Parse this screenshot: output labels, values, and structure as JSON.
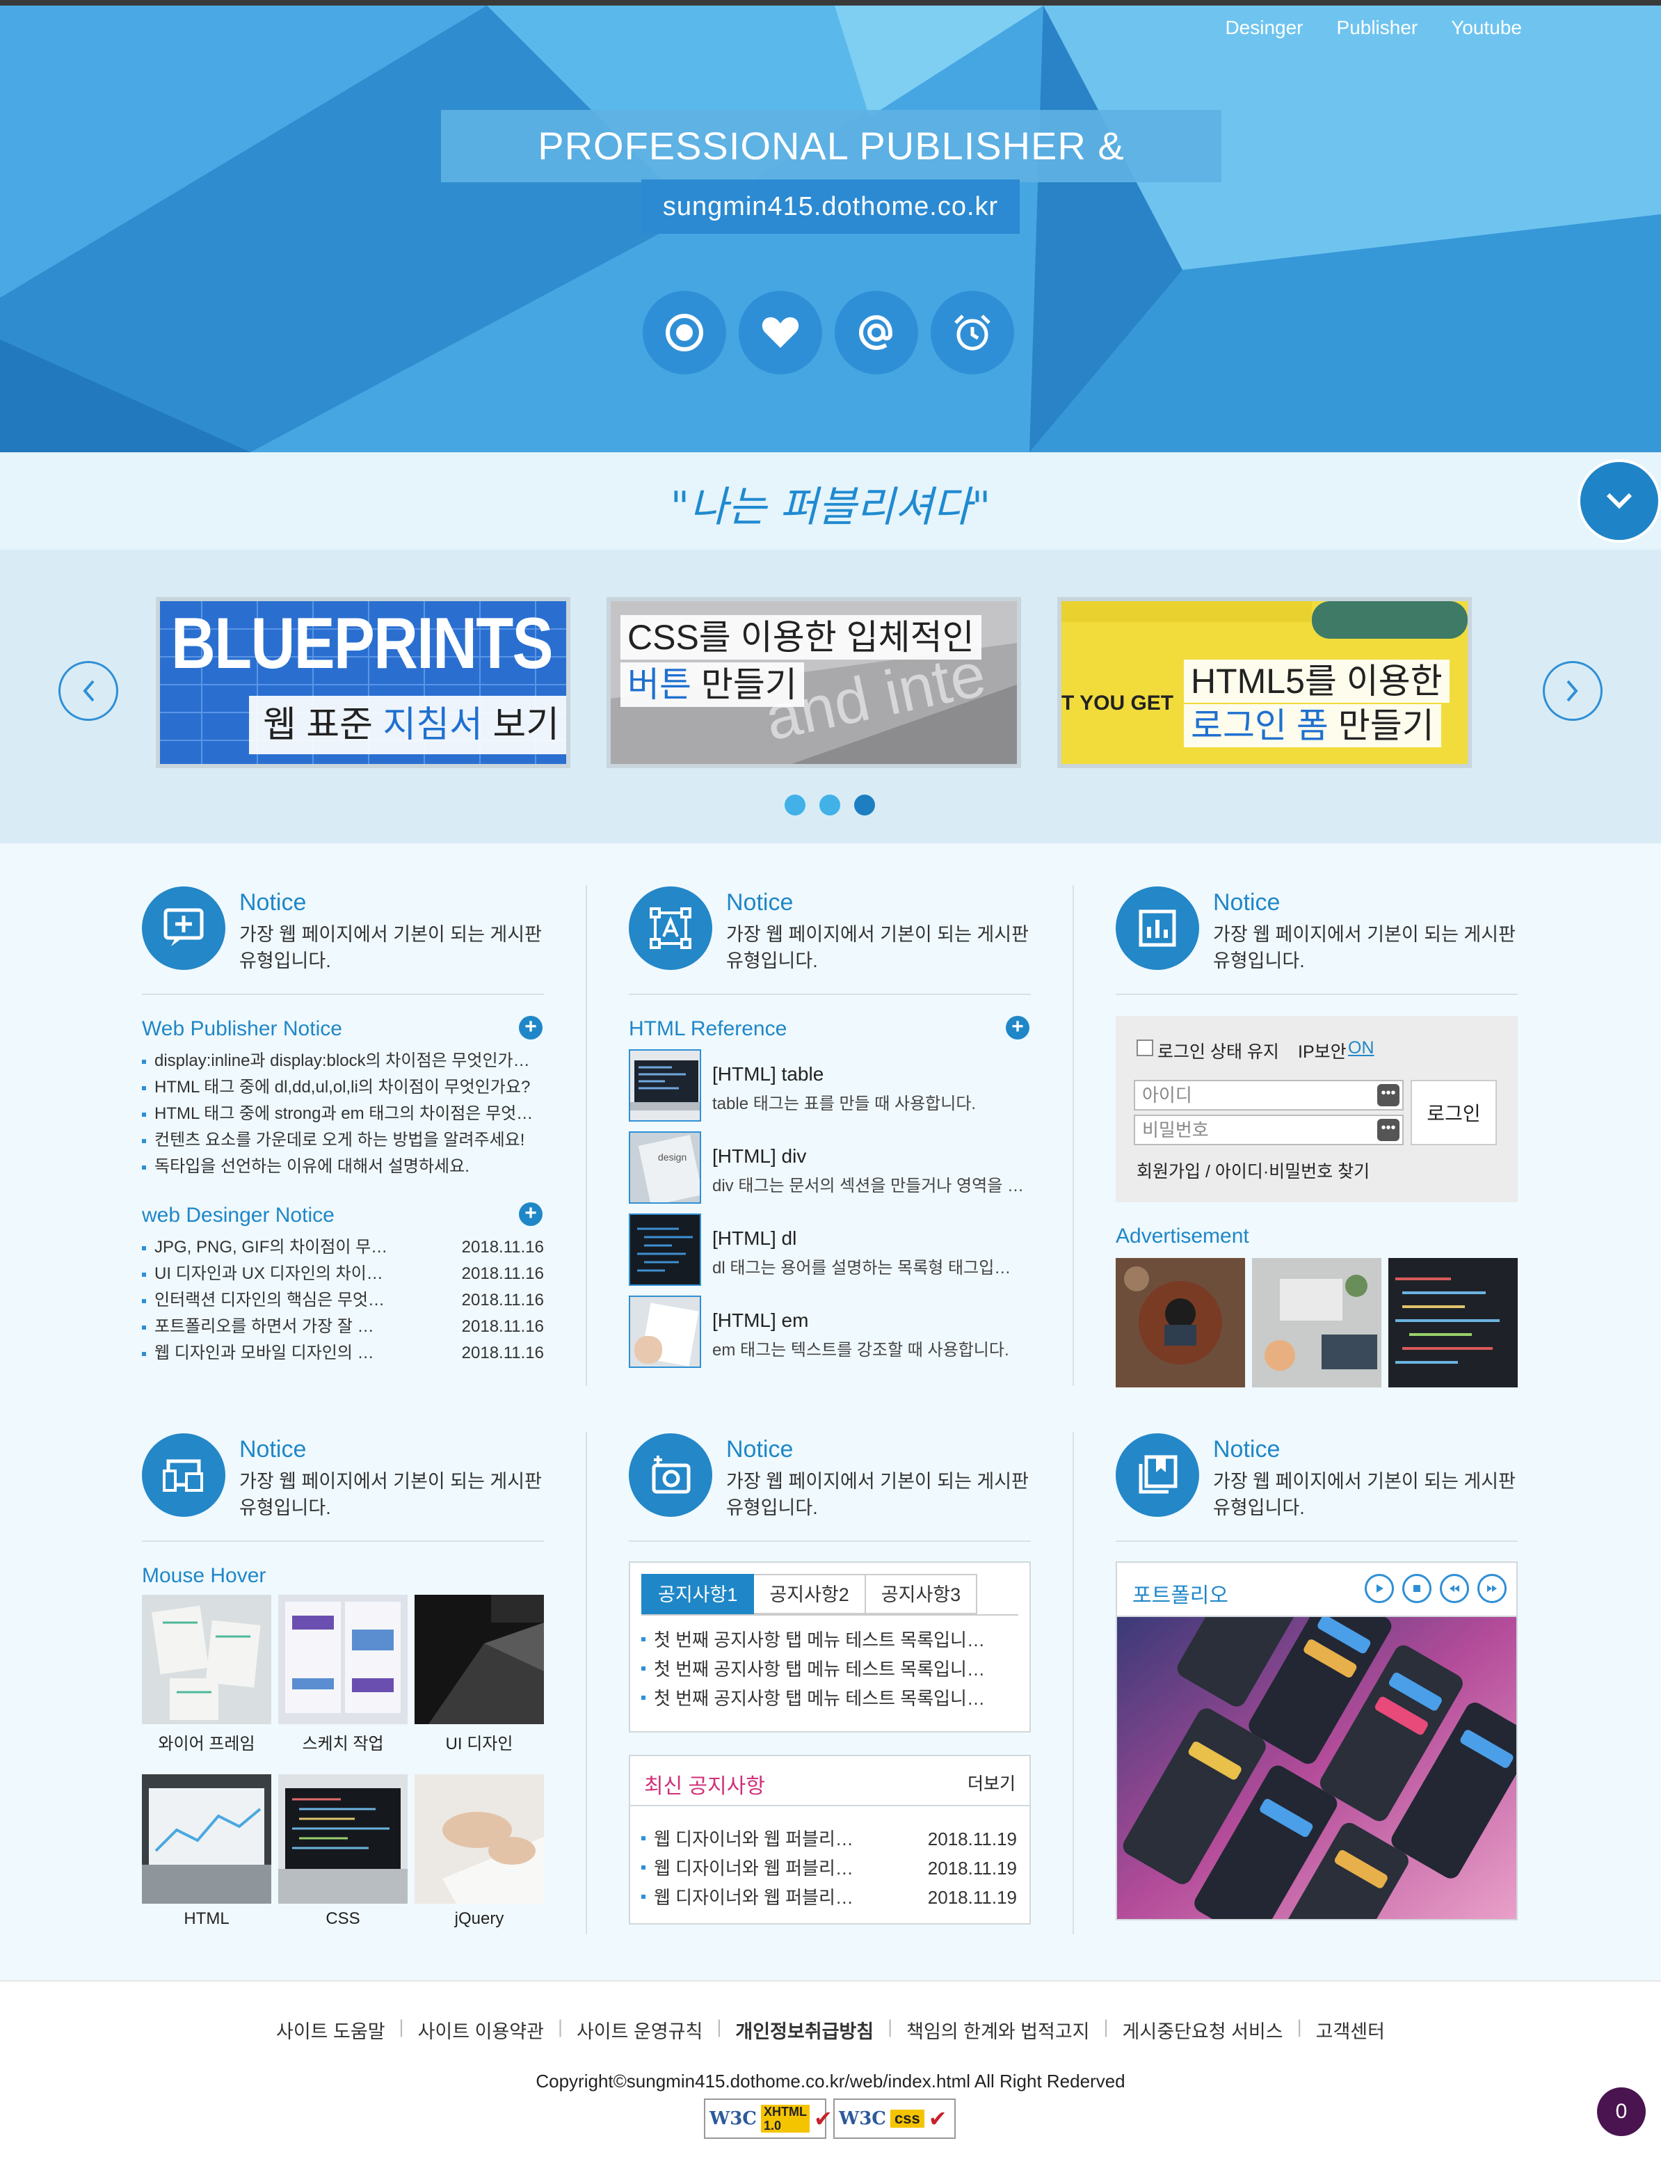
{
  "topnav": [
    "Desinger",
    "Publisher",
    "Youtube"
  ],
  "hero": {
    "title": "PROFESSIONAL PUBLISHER & DESIGNER",
    "url": "sungmin415.dothome.co.kr",
    "icons": [
      "target-icon",
      "heart-icon",
      "at-sign-icon",
      "alarm-clock-icon"
    ]
  },
  "slogan": "\"나는 퍼블리셔다\"",
  "slider": {
    "slides": [
      {
        "image_word": "BLUEPRINTS",
        "caption_plain": "웹 표준 ",
        "caption_accent": "지침서",
        "caption_end": " 보기"
      },
      {
        "line1": "CSS를 이용한 입체적인",
        "line2_accent": "버튼",
        "line2_end": " 만들기"
      },
      {
        "image_word": "T YOU GET",
        "line1": "HTML5를 이용한",
        "line2_accent": "로그인 폼",
        "line2_end": " 만들기"
      }
    ],
    "active_dot": 3
  },
  "notice_head": {
    "title": "Notice",
    "desc": "가장 웹 페이지에서 기본이 되는 게시판 유형입니다."
  },
  "col1": {
    "web_publisher": {
      "title": "Web Publisher Notice",
      "items": [
        "display:inline과 display:block의 차이점은 무엇인가…",
        "HTML 태그 중에 dl,dd,ul,ol,li의 차이점이 무엇인가요?",
        "HTML 태그 중에 strong과 em 태그의 차이점은 무엇…",
        "컨텐츠 요소를 가운데로 오게 하는 방법을 알려주세요!",
        "독타입을 선언하는 이유에 대해서 설명하세요."
      ]
    },
    "web_designer": {
      "title": "web Desinger Notice",
      "items": [
        {
          "text": "JPG, PNG, GIF의 차이점이 무…",
          "date": "2018.11.16"
        },
        {
          "text": "UI 디자인과 UX 디자인의 차이…",
          "date": "2018.11.16"
        },
        {
          "text": "인터랙션 디자인의 핵심은 무엇…",
          "date": "2018.11.16"
        },
        {
          "text": "포트폴리오를 하면서 가장 잘 …",
          "date": "2018.11.16"
        },
        {
          "text": "웹 디자인과 모바일 디자인의 …",
          "date": "2018.11.16"
        }
      ]
    }
  },
  "col2": {
    "html_reference": {
      "title": "HTML Reference",
      "items": [
        {
          "title": "[HTML] table",
          "desc": "table 태그는 표를 만들 때 사용합니다."
        },
        {
          "title": "[HTML] div",
          "desc": "div 태그는 문서의 섹션을 만들거나 영역을 …"
        },
        {
          "title": "[HTML] dl",
          "desc": "dl 태그는 용어를 설명하는 목록형 태그입…"
        },
        {
          "title": "[HTML] em",
          "desc": "em 태그는 텍스트를 강조할 때 사용합니다."
        }
      ]
    }
  },
  "col3": {
    "login": {
      "keep_login": "로그인 상태 유지",
      "ip_security": "IP보안",
      "ip_on": "ON",
      "id_placeholder": "아이디",
      "pw_placeholder": "비밀번호",
      "login_button": "로그인",
      "join": "회원가입",
      "find": "아이디·비밀번호 찾기"
    },
    "ad_title": "Advertisement"
  },
  "mouse_hover": {
    "title": "Mouse Hover",
    "items": [
      "와이어 프레임",
      "스케치 작업",
      "UI 디자인",
      "HTML",
      "CSS",
      "jQuery"
    ]
  },
  "tabs": {
    "labels": [
      "공지사항1",
      "공지사항2",
      "공지사항3"
    ],
    "items": [
      "첫 번째 공지사항 탭 메뉴 테스트 목록입니…",
      "첫 번째 공지사항 탭 메뉴 테스트 목록입니…",
      "첫 번째 공지사항 탭 메뉴 테스트 목록입니…"
    ]
  },
  "latest": {
    "title": "최신 공지사항",
    "more": "더보기",
    "items": [
      {
        "text": "웹 디자이너와 웹 퍼블리…",
        "date": "2018.11.19"
      },
      {
        "text": "웹 디자이너와 웹 퍼블리…",
        "date": "2018.11.19"
      },
      {
        "text": "웹 디자이너와 웹 퍼블리…",
        "date": "2018.11.19"
      }
    ]
  },
  "portfolio": {
    "title": "포트폴리오",
    "controls": [
      "play-icon",
      "stop-icon",
      "prev-icon",
      "next-icon"
    ]
  },
  "footer": {
    "links": [
      "사이트 도움말",
      "사이트 이용약관",
      "사이트 운영규칙",
      "개인정보취급방침",
      "책임의 한계와 법적고지",
      "게시중단요청 서비스",
      "고객센터"
    ],
    "copyright": "Copyright©sungmin415.dothome.co.kr/web/index.html All Right Rederved",
    "badges": [
      {
        "w3c": "W3C",
        "label": "XHTML",
        "version": "1.0"
      },
      {
        "w3c": "W3C",
        "label": "css"
      }
    ]
  },
  "counter": "0",
  "colors": {
    "primary": "#1f87c8",
    "hero_blue": "#3b9ad8",
    "slogan_bg": "#e6f4fb",
    "slider_bg": "#d9ecf5",
    "content_bg": "#f0f9fd",
    "counter_bg": "#4a1450"
  }
}
